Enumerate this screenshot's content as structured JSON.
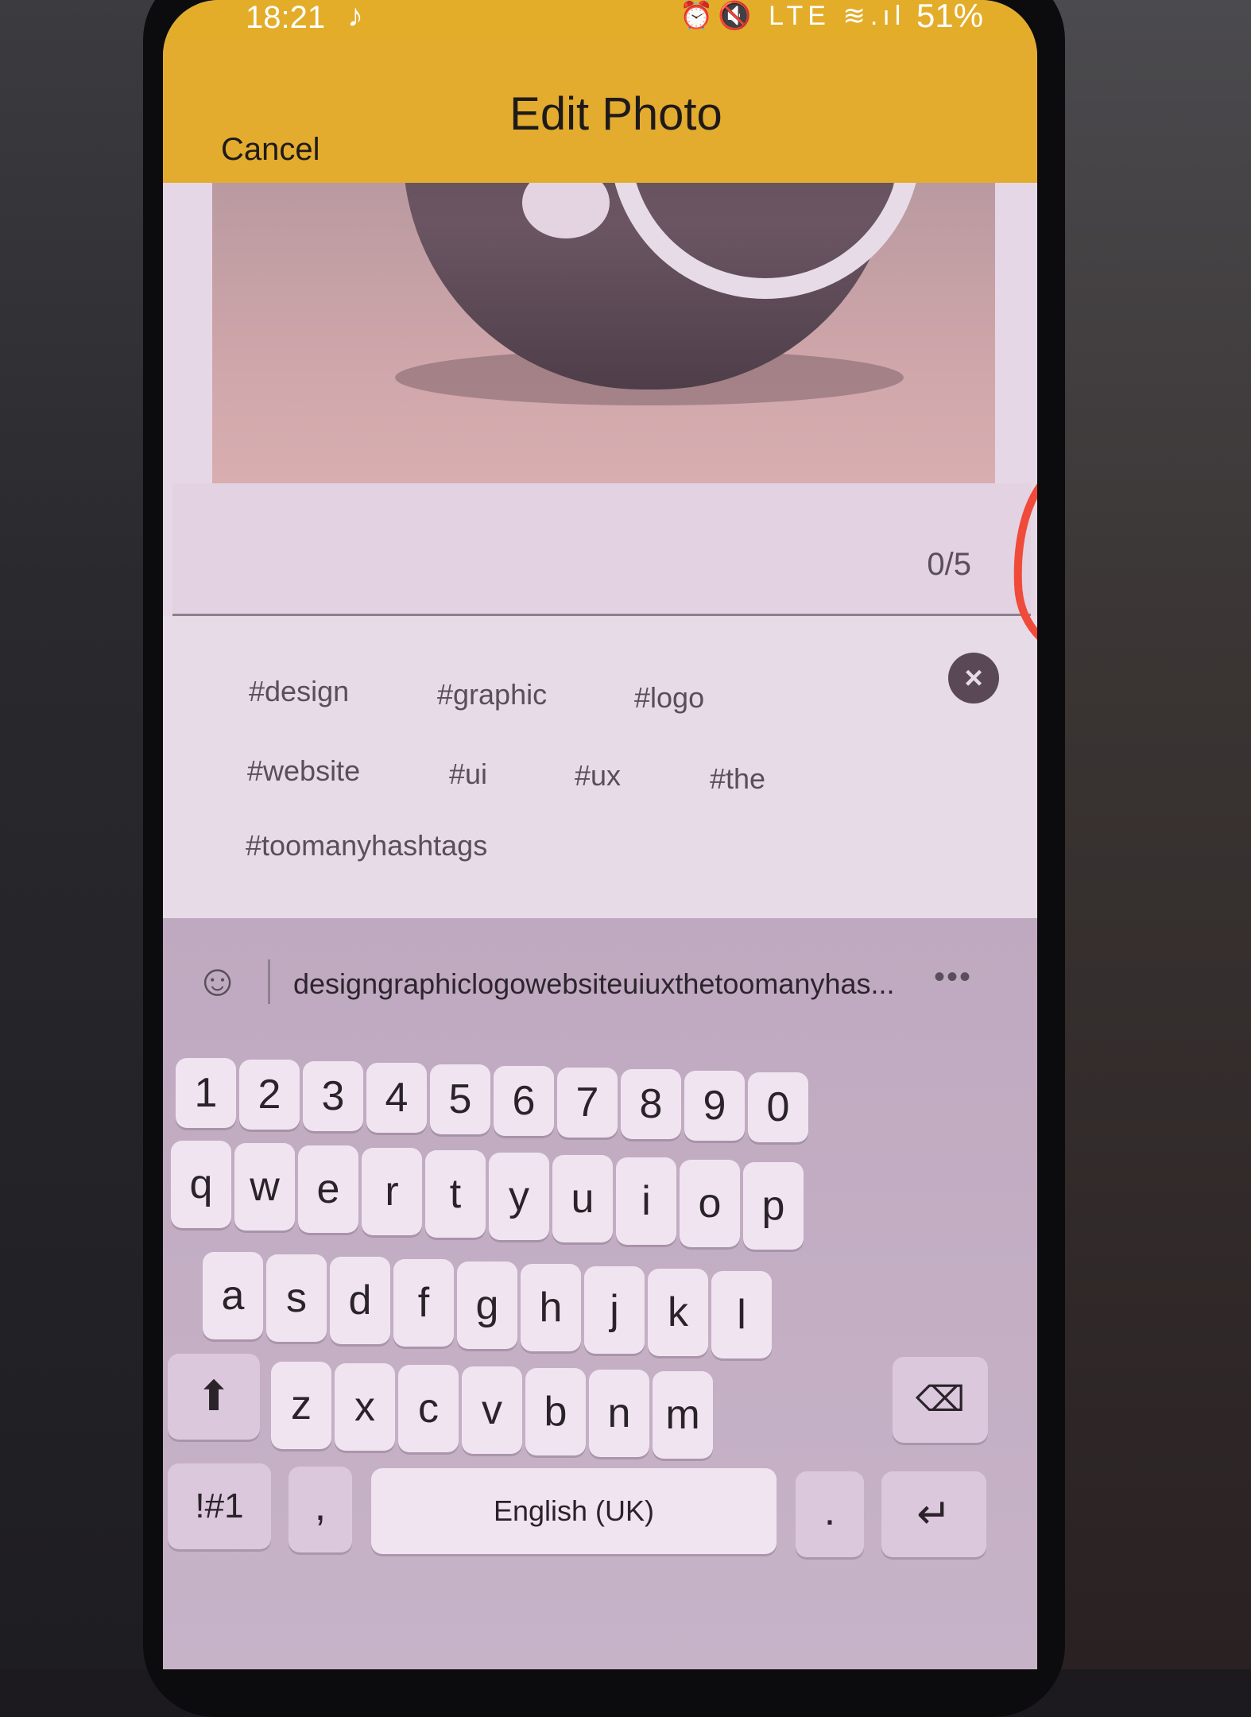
{
  "status_bar": {
    "time": "18:21",
    "note_icon": "music-note-icon",
    "icons_text": "⏰🔇 LTE ≋.ıl",
    "battery": "51%"
  },
  "header": {
    "title": "Edit Photo",
    "cancel_label": "Cancel",
    "color": "#e3ac2e"
  },
  "caption": {
    "counter": "0/5"
  },
  "hashtags": [
    {
      "label": "#design"
    },
    {
      "label": "#graphic"
    },
    {
      "label": "#logo"
    },
    {
      "label": "#website"
    },
    {
      "label": "#ui"
    },
    {
      "label": "#ux"
    },
    {
      "label": "#the"
    },
    {
      "label": "#toomanyhashtags"
    }
  ],
  "keyboard": {
    "suggestion": "designgraphiclogowebsiteuiuxthetoomanyhas...",
    "more_label": "•••",
    "row_numbers": [
      "1",
      "2",
      "3",
      "4",
      "5",
      "6",
      "7",
      "8",
      "9",
      "0"
    ],
    "row_top": [
      "q",
      "w",
      "e",
      "r",
      "t",
      "y",
      "u",
      "i",
      "o",
      "p"
    ],
    "row_mid": [
      "a",
      "s",
      "d",
      "f",
      "g",
      "h",
      "j",
      "k",
      "l"
    ],
    "row_bottom": [
      "z",
      "x",
      "c",
      "v",
      "b",
      "n",
      "m"
    ],
    "symbols_label": "!#1",
    "comma_label": ",",
    "space_label": "English (UK)",
    "period_label": ".",
    "shift_icon": "⬆",
    "backspace_icon": "⌫",
    "enter_icon": "↵"
  },
  "annotation_color": "#f04a3a"
}
